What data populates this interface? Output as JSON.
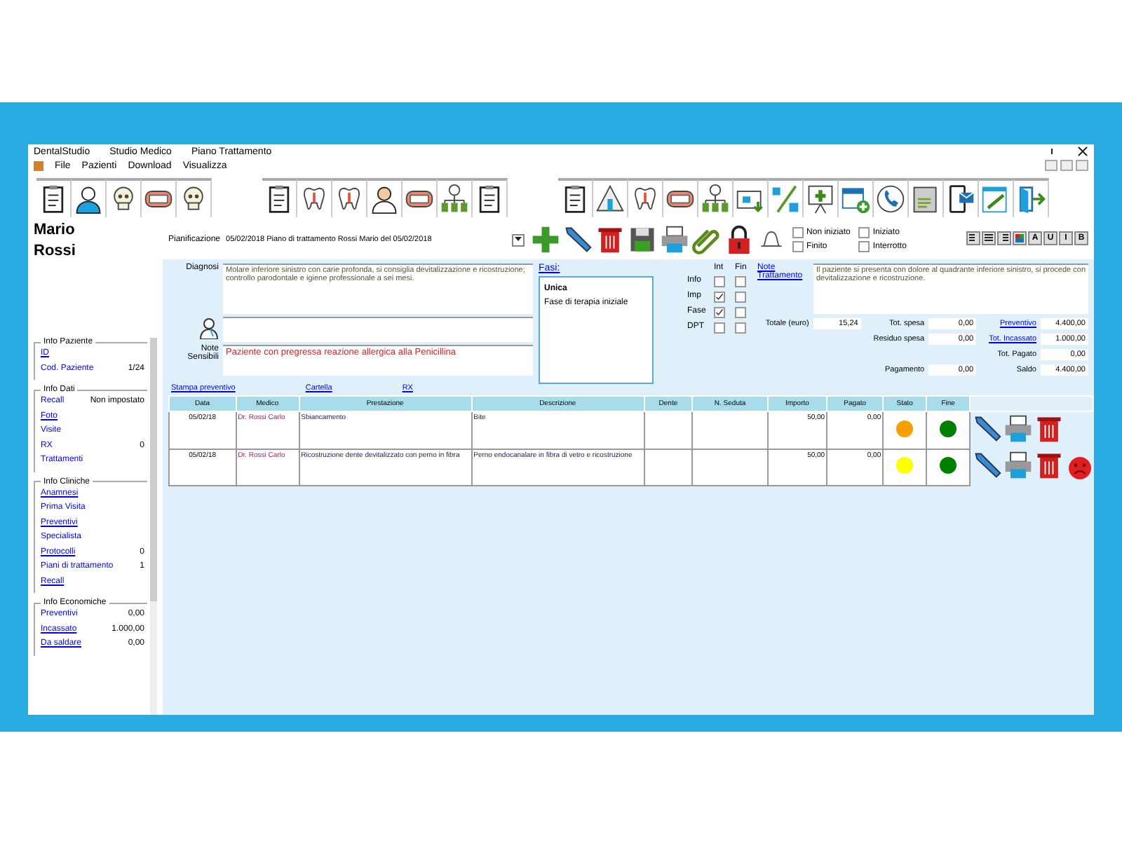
{
  "window": {
    "app": "DentalStudio",
    "title": "Studio Medico",
    "subtitle": "Piano Trattamento"
  },
  "menu": [
    "File",
    "Pazienti",
    "Download",
    "Visualizza"
  ],
  "patient": {
    "first_name": "Mario",
    "last_name": "Rossi"
  },
  "sidebar": [
    {
      "legend": "Info Paziente",
      "items": [
        {
          "label": "ID",
          "link": true
        },
        {
          "label": "Cod. Paziente",
          "link": false,
          "value": "1/24"
        }
      ]
    },
    {
      "legend": "Info Dati",
      "items": [
        {
          "label": "Recall",
          "link": false,
          "value": "Non impostato"
        },
        {
          "label": "Foto",
          "link": true
        },
        {
          "label": "Visite",
          "link": false
        },
        {
          "label": "RX",
          "link": false,
          "value": "0"
        },
        {
          "label": "Trattamenti",
          "link": false
        }
      ]
    },
    {
      "legend": "Info Cliniche",
      "items": [
        {
          "label": "Anamnesi",
          "link": true
        },
        {
          "label": "Prima Visita",
          "link": false
        },
        {
          "label": "Preventivi",
          "link": true
        },
        {
          "label": "Specialista",
          "link": false
        },
        {
          "label": "Protocolli",
          "link": true,
          "value": "0"
        },
        {
          "label": "Piani di trattamento",
          "link": false,
          "value": "1"
        },
        {
          "label": "Recall",
          "link": true
        }
      ]
    },
    {
      "legend": "Info Economiche",
      "items": [
        {
          "label": "Preventivi",
          "link": false,
          "value": "0,00"
        },
        {
          "label": "Incassato",
          "link": true,
          "value": "1.000,00"
        },
        {
          "label": "Da saldare",
          "link": true,
          "value": "0,00"
        }
      ]
    }
  ],
  "plan": {
    "label": "Pianificazione",
    "value": "05/02/2018 Piano di trattamento Rossi Mario del 05/02/2018"
  },
  "status_options": [
    {
      "label": "Non iniziato",
      "checked": false
    },
    {
      "label": "Iniziato",
      "checked": false
    },
    {
      "label": "Finito",
      "checked": false
    },
    {
      "label": "Interrotto",
      "checked": false
    }
  ],
  "format_buttons": [
    {
      "kind": "align-left"
    },
    {
      "kind": "align-center"
    },
    {
      "kind": "align-right"
    },
    {
      "kind": "color"
    },
    {
      "kind": "text",
      "label": "A"
    },
    {
      "kind": "text",
      "label": "U"
    },
    {
      "kind": "text",
      "label": "I"
    },
    {
      "kind": "text",
      "label": "B"
    }
  ],
  "diagnosis": {
    "label": "Diagnosi",
    "value": "Molare inferiore sinistro con carie profonda, si consiglia devitalizzazione e ricostruzione; controllo parodontale e igiene professionale a sei mesi."
  },
  "sensitive_notes": {
    "label": "Note Sensibili",
    "value": "Paziente con pregressa reazione allergica alla Penicillina"
  },
  "phases": {
    "link": "Fasi:",
    "items": [
      {
        "label": "Unica",
        "selected": true
      },
      {
        "label": "Fase di terapia iniziale",
        "selected": false
      }
    ]
  },
  "phase_checks": {
    "columns": [
      "Int",
      "Fin"
    ],
    "rows": [
      {
        "label": "Info",
        "int": false,
        "fin": false
      },
      {
        "label": "Imp",
        "int": true,
        "fin": false
      },
      {
        "label": "Fase",
        "int": true,
        "fin": false
      },
      {
        "label": "DPT",
        "int": false,
        "fin": false
      }
    ]
  },
  "treatment_notes": {
    "link": "Note Trattamento",
    "value": "Il paziente si presenta con dolore al quadrante inferiore sinistro, si procede con devitalizzazione e ricostruzione."
  },
  "amounts": [
    [
      {
        "kind": "field",
        "label": "Totale (euro)",
        "link": false,
        "value": "15,24"
      },
      {
        "kind": "field",
        "label": "Tot. spesa",
        "link": false,
        "value": "0,00"
      },
      {
        "kind": "field",
        "label": "Preventivo",
        "link": true,
        "value": "4.400,00"
      }
    ],
    [
      {
        "kind": "blank"
      },
      {
        "kind": "field",
        "label": "Residuo spesa",
        "link": false,
        "value": "0,00"
      },
      {
        "kind": "field",
        "label": "Tot. Incassato",
        "link": true,
        "value": "1.000,00"
      }
    ],
    [
      {
        "kind": "blank"
      },
      {
        "kind": "blank"
      },
      {
        "kind": "field",
        "label": "Tot. Pagato",
        "link": false,
        "value": "0,00"
      }
    ],
    [
      {
        "kind": "blank"
      },
      {
        "kind": "field",
        "label": "Pagamento",
        "link": false,
        "value": "0,00"
      },
      {
        "kind": "field",
        "label": "Saldo",
        "link": false,
        "value": "4.400,00"
      }
    ]
  ],
  "links": [
    "Stampa preventivo",
    "Cartella",
    "RX"
  ],
  "table": {
    "columns": [
      "Data",
      "Medico",
      "Prestazione",
      "Descrizione",
      "Dente",
      "N. Seduta",
      "Importo",
      "Pagato",
      "Stato",
      "Fine"
    ],
    "rows": [
      {
        "date": "05/02/18",
        "doctor": "Dr. Rossi Carlo",
        "treatment": "Sbiancamento",
        "description": "Bite",
        "amount": "50,00",
        "paid": "0,00",
        "status": {
          "color": "#f5a000"
        },
        "end": {
          "color": "#008000"
        },
        "alert": false
      },
      {
        "date": "05/02/18",
        "doctor": "Dr. Rossi Carlo",
        "treatment": "Ricostruzione dente devitalizzato con perno in fibra",
        "description": "Perno endocanalare in fibra di vetro e ricostruzione",
        "amount": "50,00",
        "paid": "0,00",
        "status": {
          "color": "#ffff00"
        },
        "end": {
          "color": "#008000"
        },
        "alert": true
      }
    ]
  }
}
